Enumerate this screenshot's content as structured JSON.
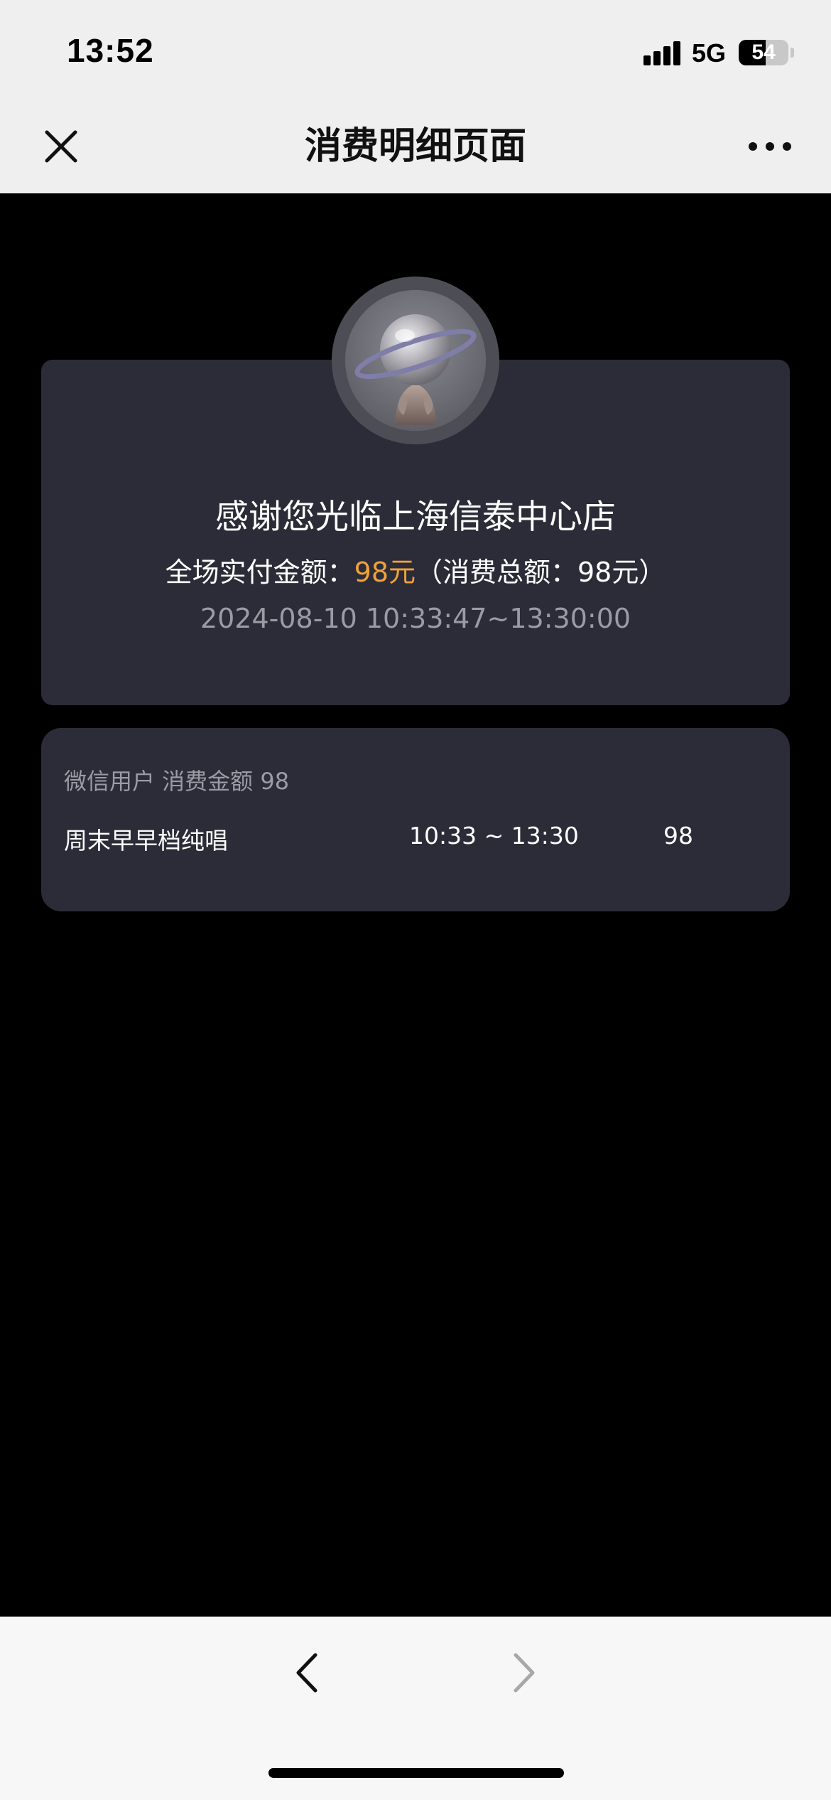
{
  "status_bar": {
    "time": "13:52",
    "network": "5G",
    "battery": "54",
    "battery_level": 0.54,
    "icons": [
      "signal-bars-icon",
      "battery-icon"
    ]
  },
  "nav": {
    "title": "消费明细页面",
    "close_icon": "close-icon",
    "more_icon": "more-dots-icon"
  },
  "summary": {
    "welcome": "感谢您光临上海信泰中心店",
    "paid_label": "全场实付金额：",
    "paid_amount": "98元",
    "total_text": "（消费总额：98元）",
    "time_range": "2024-08-10 10:33:47~13:30:00",
    "avatar_icon": "mascot-avatar-icon"
  },
  "detail": {
    "user_line": "微信用户 消费金额 98",
    "items": [
      {
        "name": "周末早早档纯唱",
        "time": "10:33 ~ 13:30",
        "amount": "98"
      }
    ]
  },
  "toolbar": {
    "back_icon": "chevron-left-icon",
    "forward_icon": "chevron-right-icon"
  },
  "colors": {
    "page_bg": "#000000",
    "card_bg": "#2b2c37",
    "accent_orange": "#f0a13e",
    "muted_text": "#9a9ba5",
    "header_bg": "#efefef"
  }
}
